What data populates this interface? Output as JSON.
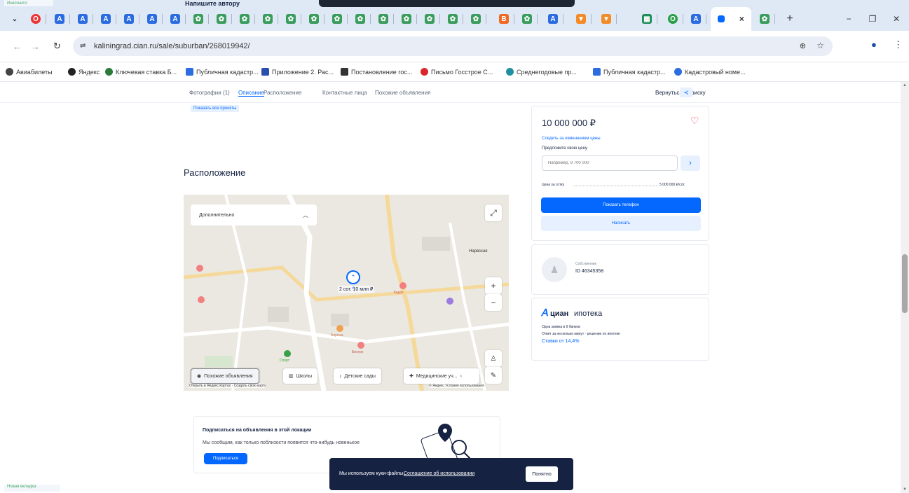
{
  "browser": {
    "tab_tooltip_text": "Напишите автору",
    "active_tab_close": "×",
    "new_tab": "+",
    "window_controls": {
      "minimize": "−",
      "maximize": "❐",
      "close": "✕"
    },
    "url": "kaliningrad.cian.ru/sale/suburban/268019942/",
    "bookmarks": [
      "Авиабилеты",
      "Яндекс",
      "Ключевая ставка Б...",
      "Публичная кадастр...",
      "Приложение 2. Рас...",
      "Постановление гос...",
      "Письмо Госстрое С...",
      "Среднегодовые пр...",
      "Публичная кадастр...",
      "Кадастровый номе..."
    ],
    "tab_labels": [
      "Инкогнито",
      "Новая вкладка"
    ]
  },
  "page_nav": {
    "items": [
      "Фотографии (1)",
      "Описание",
      "Расположение",
      "Контактные лица",
      "Похожие объявления"
    ],
    "active_index": 1,
    "right_text": "Вернуться к поиску"
  },
  "top_link": "Показать все проекты",
  "location": {
    "title": "Расположение"
  },
  "map": {
    "dropdown_label": "Дополнительно",
    "marker_label": "2 сот. 10 млн ₽",
    "chips": [
      "Похожие объявления",
      "Школы",
      "Детские сады",
      "Медицинские уч..."
    ],
    "attribution_left": "Открыть в Яндекс.Картах · Создать свою карту",
    "attribution_right": "© Яндекс Условия использования",
    "poi_labels": [
      "Нарвская",
      "Кадзэ",
      "Бирюза",
      "Бистро",
      "Спорт"
    ],
    "zoom_in": "+",
    "zoom_out": "−"
  },
  "subscribe": {
    "title": "Подписаться на объявления в этой локации",
    "subtitle": "Мы сообщим, как только поблизости появится что-нибудь новенькое",
    "button": "Подписаться"
  },
  "price_card": {
    "price": "10 000 000 ₽",
    "follow_link": "Следить за изменением цены",
    "offer_label": "Предложите свою цену",
    "offer_placeholder": "Например, 9 700 000",
    "offer_submit": "›",
    "per_area_label": "Цена за сотку",
    "per_area_value": "5 000 000 ₽/сот.",
    "show_phone": "Показать телефон",
    "write": "Написать"
  },
  "agent_card": {
    "role": "Собственник",
    "id": "ID 46345358"
  },
  "mortgage_card": {
    "logo_brand": "циан",
    "logo_product": "ипотека",
    "line1": "Одна заявка в 9 банков",
    "line2": "Ответ за несколько минут · решение по ипотеке",
    "rate_link": "Ставки от 14,4%"
  },
  "cookie_banner": {
    "text": "Мы используем куки-файлы.",
    "link": "Соглашение об использовании",
    "button": "Понятно"
  },
  "colors": {
    "accent": "#0468ff",
    "dark": "#152242",
    "tab_bg": "#dfe8f5"
  }
}
